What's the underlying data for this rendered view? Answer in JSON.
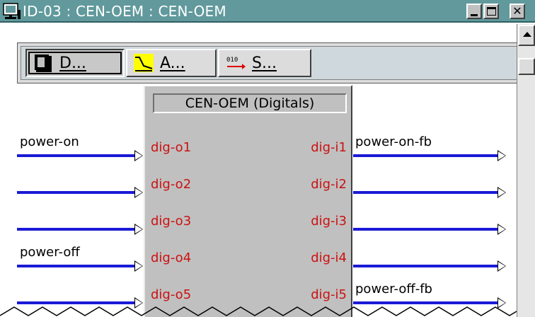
{
  "window": {
    "title": "ID-03 : CEN-OEM : CEN-OEM",
    "title_icon": "computer-icon",
    "controls": [
      "minimize",
      "maximize",
      "close"
    ],
    "close_glyph": "✕"
  },
  "toolbar": {
    "buttons": [
      {
        "label": "D...",
        "icon": "device-icon",
        "pressed": true
      },
      {
        "label": "A...",
        "icon": "analog-icon",
        "pressed": false
      },
      {
        "label": "S...",
        "icon": "serial-icon",
        "pressed": false
      }
    ]
  },
  "device": {
    "title": "CEN-OEM (Digitals)",
    "outputs": [
      "dig-o1",
      "dig-o2",
      "dig-o3",
      "dig-o4",
      "dig-o5"
    ],
    "inputs": [
      "dig-i1",
      "dig-i2",
      "dig-i3",
      "dig-i4",
      "dig-i5"
    ]
  },
  "signals": {
    "left": [
      "power-on",
      "",
      "",
      "power-off",
      ""
    ],
    "right": [
      "power-on-fb",
      "",
      "",
      "",
      "power-off-fb"
    ]
  },
  "colors": {
    "titlebar": "#61999c",
    "wire": "#1a1ad6",
    "port_text": "#cc1111",
    "block": "#c0c0c0"
  }
}
